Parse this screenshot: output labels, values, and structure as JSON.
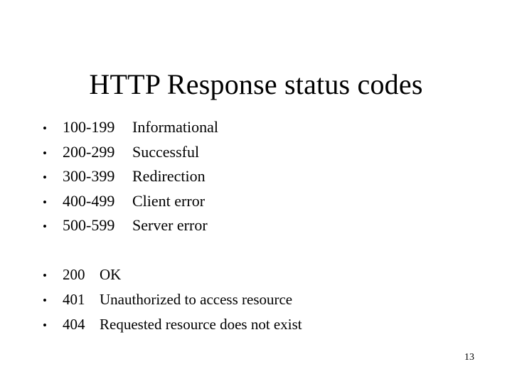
{
  "slide": {
    "title": "HTTP Response status codes",
    "page_number": "13",
    "background_color": "#ffffff",
    "text_color": "#000000",
    "bullet_glyph": "•"
  },
  "status_ranges": {
    "bullet": "•",
    "items": [
      {
        "code": "100-199",
        "description": "Informational"
      },
      {
        "code": "200-299",
        "description": "Successful"
      },
      {
        "code": "300-399",
        "description": "Redirection"
      },
      {
        "code": "400-499",
        "description": "Client error"
      },
      {
        "code": "500-599",
        "description": "Server error"
      }
    ]
  },
  "status_examples": {
    "bullet": "•",
    "items": [
      {
        "code": "200",
        "description": "OK"
      },
      {
        "code": "401",
        "description": "Unauthorized to access resource"
      },
      {
        "code": "404",
        "description": "Requested resource does not exist"
      }
    ]
  }
}
